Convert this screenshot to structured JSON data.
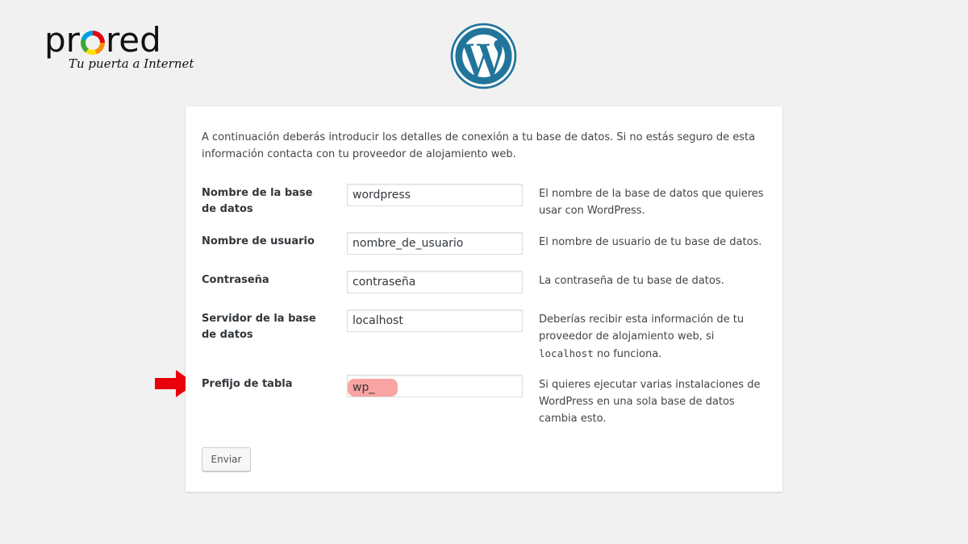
{
  "branding": {
    "prored_word_pre": "pr",
    "prored_word_post": "red",
    "prored_tagline": "Tu puerta a Internet"
  },
  "colors": {
    "wordpress_blue": "#21759b",
    "highlight": "#f9a3a3",
    "arrow": "#e8000b"
  },
  "form": {
    "intro": "A continuación deberás introducir los detalles de conexión a tu base de datos. Si no estás seguro de esta información contacta con tu proveedor de alojamiento web.",
    "fields": [
      {
        "label": "Nombre de la base de datos",
        "value": "wordpress",
        "description": "El nombre de la base de datos que quieres usar con WordPress."
      },
      {
        "label": "Nombre de usuario",
        "value": "nombre_de_usuario",
        "description": "El nombre de usuario de tu base de datos."
      },
      {
        "label": "Contraseña",
        "value": "contraseña",
        "description": "La contraseña de tu base de datos."
      },
      {
        "label": "Servidor de la base de datos",
        "value": "localhost",
        "description_pre": "Deberías recibir esta información de tu proveedor de alojamiento web, si ",
        "description_code": "localhost",
        "description_post": " no funciona."
      },
      {
        "label": "Prefijo de tabla",
        "value": "wp_",
        "description": "Si quieres ejecutar varias instalaciones de WordPress en una sola base de datos cambia esto."
      }
    ],
    "submit_label": "Enviar"
  }
}
